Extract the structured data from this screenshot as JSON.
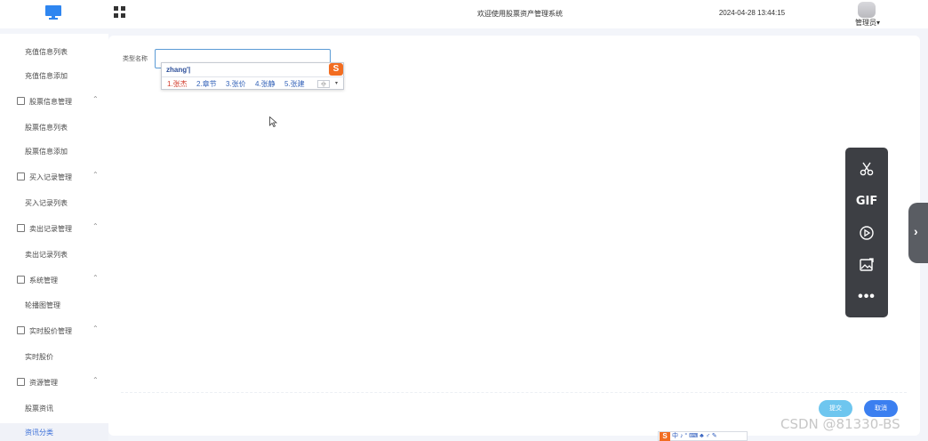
{
  "header": {
    "welcome": "欢迎使用股票资产管理系统",
    "datetime": "2024-04-28 13:44:15",
    "user": "管理员"
  },
  "sidebar": {
    "items": [
      {
        "label": "充值信息列表",
        "type": "child"
      },
      {
        "label": "充值信息添加",
        "type": "child"
      },
      {
        "label": "股票信息管理",
        "type": "group",
        "icon": "chart-icon"
      },
      {
        "label": "股票信息列表",
        "type": "child"
      },
      {
        "label": "股票信息添加",
        "type": "child"
      },
      {
        "label": "买入记录管理",
        "type": "group",
        "icon": "chart-icon"
      },
      {
        "label": "买入记录列表",
        "type": "child"
      },
      {
        "label": "卖出记录管理",
        "type": "group",
        "icon": "chart-icon"
      },
      {
        "label": "卖出记录列表",
        "type": "child"
      },
      {
        "label": "系统管理",
        "type": "group",
        "icon": "folder-icon"
      },
      {
        "label": "轮播图管理",
        "type": "child"
      },
      {
        "label": "实时股价管理",
        "type": "group",
        "icon": "gear-icon"
      },
      {
        "label": "实时股价",
        "type": "child"
      },
      {
        "label": "资源管理",
        "type": "group",
        "icon": "monitor-icon"
      },
      {
        "label": "股票资讯",
        "type": "child"
      },
      {
        "label": "资讯分类",
        "type": "child",
        "active": true
      }
    ]
  },
  "form": {
    "type_label": "类型名称",
    "type_value": ""
  },
  "ime": {
    "composition": "zhang'|",
    "candidates": [
      "1.张杰",
      "2.章节",
      "3.张价",
      "4.张静",
      "5.张建"
    ],
    "pager": "‹|›",
    "logo": "S"
  },
  "buttons": {
    "submit": "提交",
    "cancel": "取消"
  },
  "float_toolbar": {
    "gif": "GIF",
    "more": "•••"
  },
  "sogou_bar": {
    "logo": "S",
    "text": "中 ♪ ° ⌨ ♣ ♂ ✎"
  },
  "watermark": "CSDN @81330-BS",
  "colors": {
    "accent": "#3b7ff0",
    "submit": "#6ec6ef",
    "ime_logo": "#f26d21"
  }
}
